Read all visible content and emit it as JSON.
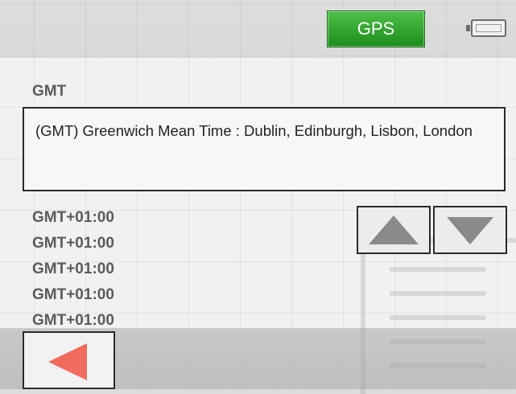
{
  "statusbar": {
    "gps_label": "GPS",
    "battery_icon": "battery-icon",
    "gps_color": "#2fa52a"
  },
  "timezone": {
    "current_label": "GMT",
    "current_description": "(GMT) Greenwich Mean Time : Dublin, Edinburgh, Lisbon, London"
  },
  "list": {
    "items": [
      "GMT+01:00",
      "GMT+01:00",
      "GMT+01:00",
      "GMT+01:00",
      "GMT+01:00"
    ]
  },
  "controls": {
    "scroll_up_icon": "triangle-up-icon",
    "scroll_down_icon": "triangle-down-icon",
    "back_icon": "triangle-left-icon",
    "back_color": "#f06a5e"
  }
}
